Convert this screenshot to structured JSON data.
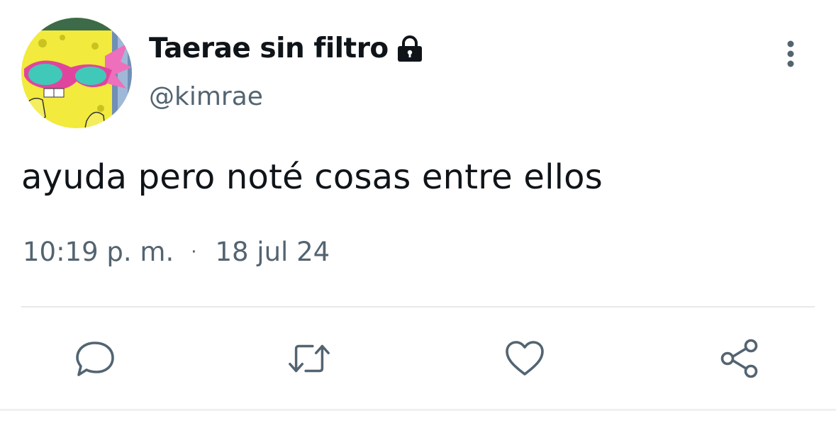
{
  "author": {
    "display_name": "Taerae sin filtro",
    "handle": "@kimrae",
    "protected": true,
    "avatar": "spongebob-with-pink-sunglasses"
  },
  "tweet": {
    "text": "ayuda pero noté cosas entre ellos",
    "time": "10:19 p. m.",
    "separator": "·",
    "date": "18 jul 24"
  },
  "actions": [
    {
      "name": "reply",
      "icon": "comment-icon"
    },
    {
      "name": "retweet",
      "icon": "retweet-icon"
    },
    {
      "name": "like",
      "icon": "heart-icon"
    },
    {
      "name": "share",
      "icon": "share-icon"
    }
  ],
  "colors": {
    "text_primary": "#0f1419",
    "text_secondary": "#536471",
    "divider": "#e7e9ea"
  }
}
